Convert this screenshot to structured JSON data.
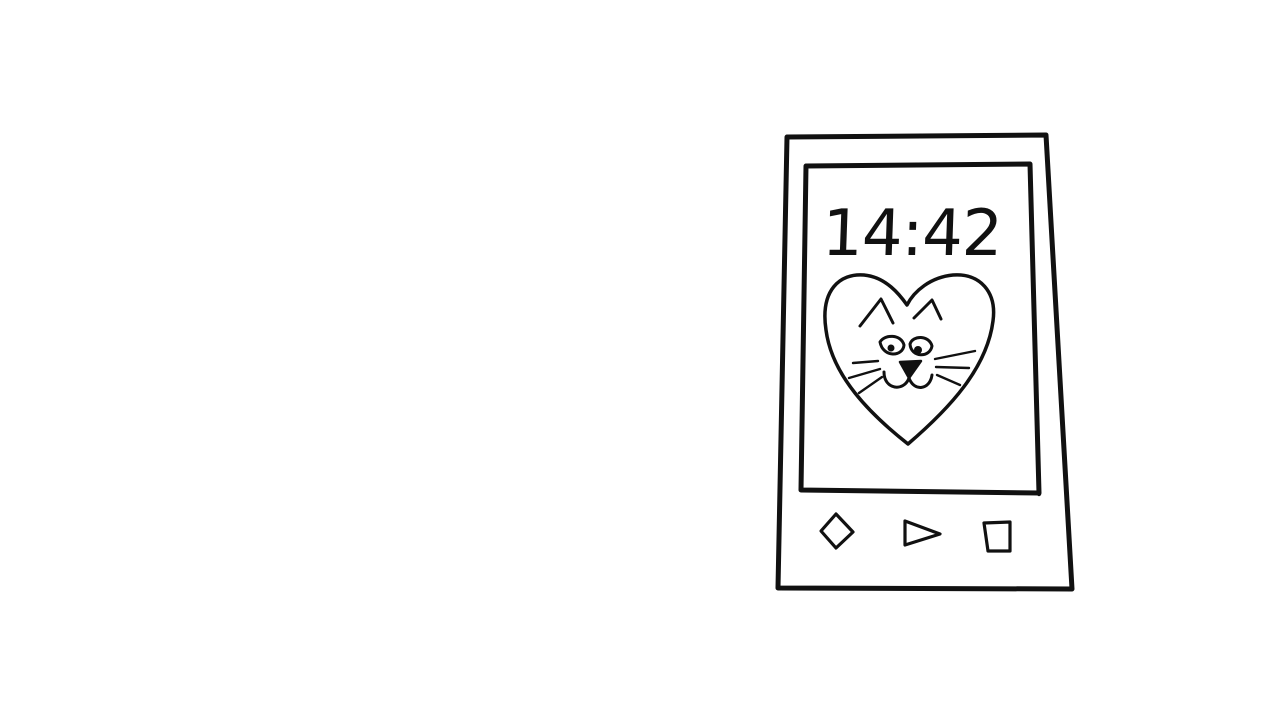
{
  "lockscreen": {
    "clock_text": "14:42",
    "wallpaper": "heart-cat-face"
  },
  "nav_bar": {
    "buttons": [
      {
        "icon": "diamond-icon"
      },
      {
        "icon": "play-triangle-icon"
      },
      {
        "icon": "square-icon"
      }
    ]
  },
  "colors": {
    "ink": "#111111",
    "background": "#ffffff"
  }
}
